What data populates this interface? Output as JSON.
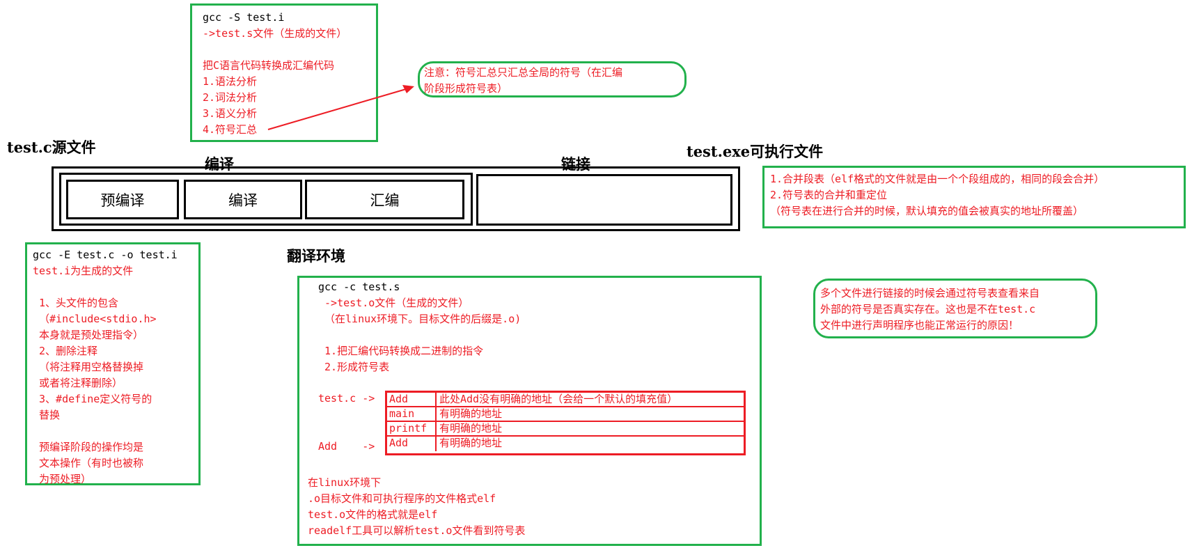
{
  "top_note": {
    "lines": [
      "gcc -S test.i",
      "->test.s文件（生成的文件）",
      "",
      "把C语言代码转换成汇编代码",
      "1.语法分析",
      "2.词法分析",
      "3.语义分析",
      "4.符号汇总"
    ]
  },
  "callout_top": {
    "lines": [
      "注意：符号汇总只汇总全局的符号（在汇编",
      "阶段形成符号表）"
    ]
  },
  "labels": {
    "source": "test.c源文件",
    "compile_group": "编译",
    "link_group": "链接",
    "exe": "test.exe可执行文件",
    "env": "翻译环境"
  },
  "stages": [
    "预编译",
    "编译",
    "汇编"
  ],
  "link_note": {
    "lines": [
      "1.合并段表（elf格式的文件就是由一个个段组成的，相同的段会合并）",
      "2.符号表的合并和重定位",
      "（符号表在进行合并的时候，默认填充的值会被真实的地址所覆盖）"
    ]
  },
  "precompile_note": {
    "lines": [
      "gcc -E test.c -o test.i",
      "test.i为生成的文件",
      "",
      " 1、头文件的包含",
      " （#include<stdio.h>",
      " 本身就是预处理指令）",
      " 2、删除注释",
      " （将注释用空格替换掉",
      " 或者将注释删除）",
      " 3、#define定义符号的",
      " 替换",
      "",
      " 预编译阶段的操作均是",
      " 文本操作（有时也被称",
      " 为预处理）"
    ]
  },
  "assemble_note": {
    "top_lines": [
      "gcc -c test.s",
      " ->test.o文件（生成的文件）",
      " （在linux环境下。目标文件的后缀是.o)",
      "",
      " 1.把汇编代码转换成二进制的指令",
      " 2.形成符号表"
    ],
    "label_testc": "test.c ->",
    "label_add": "Add    ->",
    "table": [
      {
        "symbol": "Add",
        "desc": "此处Add没有明确的地址（会给一个默认的填充值）"
      },
      {
        "symbol": "main",
        "desc": "有明确的地址"
      },
      {
        "symbol": "printf",
        "desc": "有明确的地址"
      },
      {
        "symbol": "Add",
        "desc": "有明确的地址"
      }
    ],
    "bottom_lines": [
      "在linux环境下",
      ".o目标文件和可执行程序的文件格式elf",
      "test.o文件的格式就是elf",
      "readelf工具可以解析test.o文件看到符号表"
    ]
  },
  "callout_right": {
    "lines": [
      "多个文件进行链接的时候会通过符号表查看来自",
      "外部的符号是否真实存在。这也是不在test.c",
      "文件中进行声明程序也能正常运行的原因！"
    ]
  },
  "colors": {
    "red_text": "#ed1c24",
    "green_border": "#22b14c",
    "black": "#000000"
  }
}
